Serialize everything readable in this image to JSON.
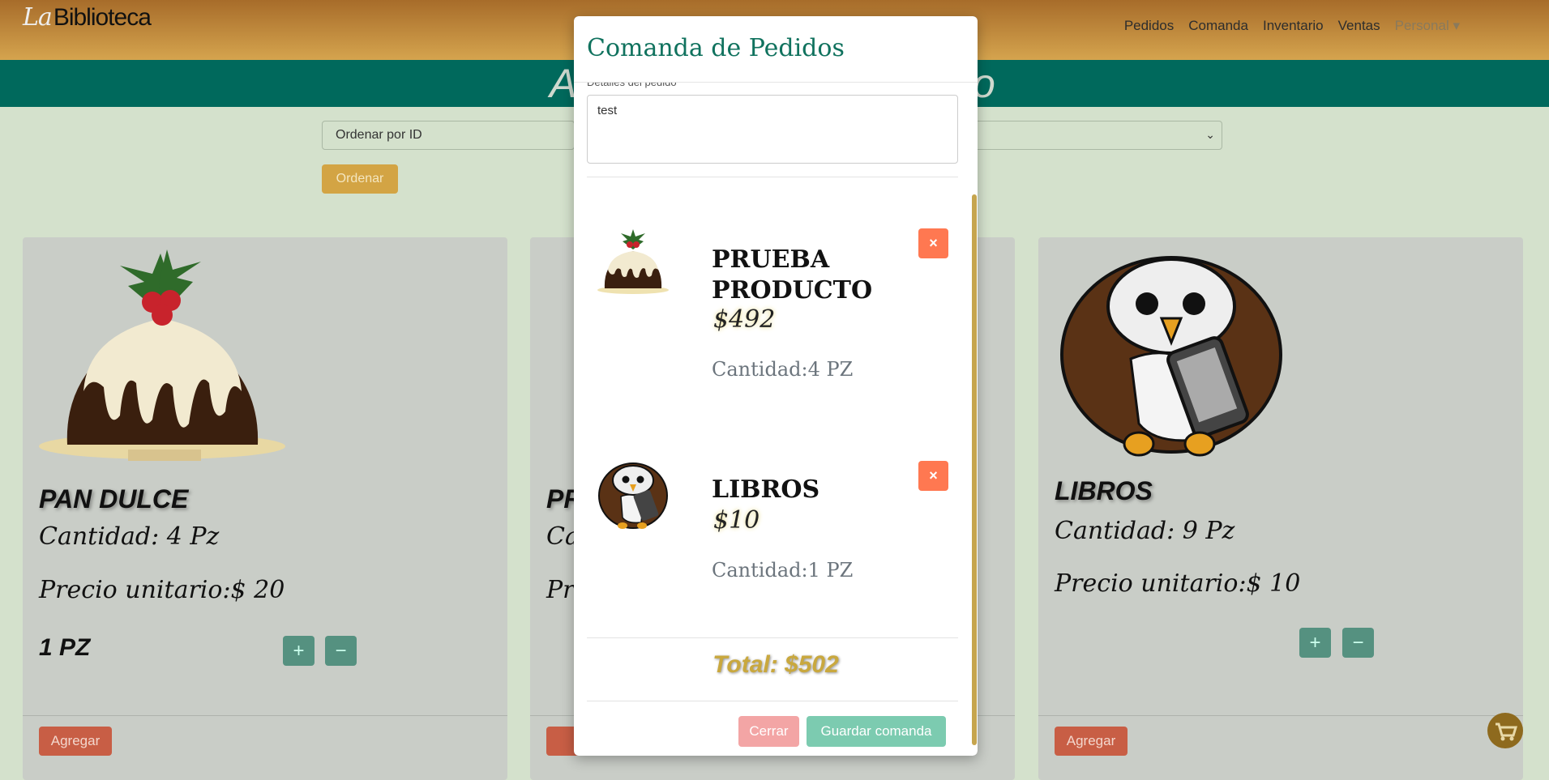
{
  "nav": {
    "brand_prefix": "La",
    "brand_name": "Biblioteca",
    "links": [
      "Pedidos",
      "Comanda",
      "Inventario",
      "Ventas",
      "Personal ▾"
    ]
  },
  "banner": {
    "text_left": "A",
    "text_right": "o"
  },
  "controls": {
    "sort_select": "Ordenar por ID",
    "order_button": "Ordenar"
  },
  "cards": [
    {
      "name": "PAN DULCE",
      "cantidad": "Cantidad: 4 Pz",
      "precio": "Precio unitario:$ 20",
      "qty": "1 PZ",
      "plus": "+",
      "minus": "−",
      "add": "Agregar"
    },
    {
      "name": "PR",
      "cantidad": "Ca",
      "precio": "Pr",
      "add": "Ag"
    },
    {
      "name": "LIBROS",
      "cantidad": "Cantidad: 9 Pz",
      "precio": "Precio unitario:$ 10",
      "plus": "+",
      "minus": "−",
      "add": "Agregar"
    }
  ],
  "modal": {
    "title": "Comanda de Pedidos",
    "details_label": "Detalles del pedido",
    "details_value": "test",
    "items": [
      {
        "name": "PRUEBA PRODUCTO",
        "price": "$492",
        "qty": "Cantidad:4 PZ",
        "remove": "×",
        "icon": "pudding-icon"
      },
      {
        "name": "LIBROS",
        "price": "$10",
        "qty": "Cantidad:1 PZ",
        "remove": "×",
        "icon": "owl-icon"
      }
    ],
    "total": "Total: $502",
    "close_label": "Cerrar",
    "save_label": "Guardar comanda"
  },
  "colors": {
    "primary": "#00695c",
    "accent": "#d3a444",
    "danger": "#ff7851",
    "success": "#7ccbb0"
  }
}
